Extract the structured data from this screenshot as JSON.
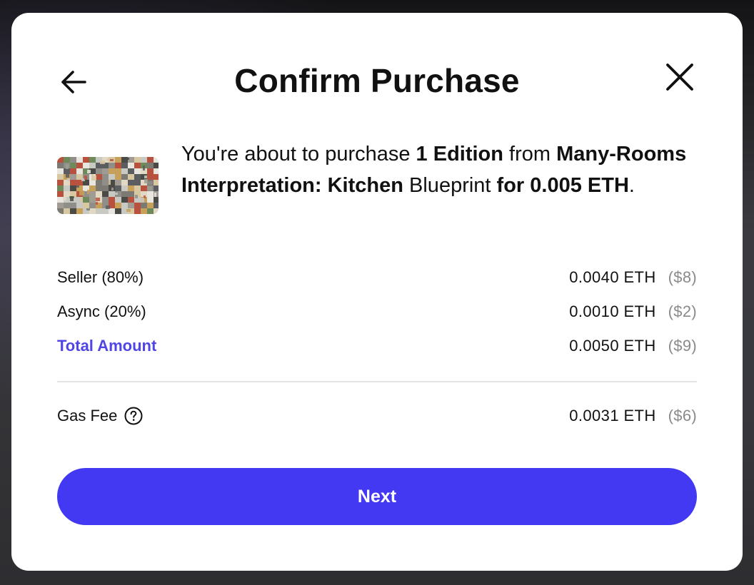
{
  "modal": {
    "title": "Confirm Purchase",
    "back_icon": "arrow-left-icon",
    "close_icon": "close-icon"
  },
  "purchase": {
    "thumbnail": "artwork-thumbnail",
    "text_intro": "You're about to purchase ",
    "quantity": "1 Edition",
    "text_from": " from ",
    "artwork_name": "Many-Rooms Interpretation: Kitchen",
    "artwork_type": " Blueprint ",
    "text_for": "for",
    "price": "0.005 ETH",
    "text_end": "."
  },
  "breakdown": [
    {
      "label": "Seller (80%)",
      "eth": "0.0040 ETH",
      "usd": "($8)",
      "accent": false
    },
    {
      "label": "Async (20%)",
      "eth": "0.0010 ETH",
      "usd": "($2)",
      "accent": false
    },
    {
      "label": "Total Amount",
      "eth": "0.0050 ETH",
      "usd": "($9)",
      "accent": true
    }
  ],
  "gas": {
    "label": "Gas Fee",
    "help_icon": "question-circle-icon",
    "eth": "0.0031 ETH",
    "usd": "($6)"
  },
  "actions": {
    "next_label": "Next"
  },
  "colors": {
    "accent": "#4f46e5",
    "button": "#4339f2",
    "muted": "#8a8a8a"
  }
}
